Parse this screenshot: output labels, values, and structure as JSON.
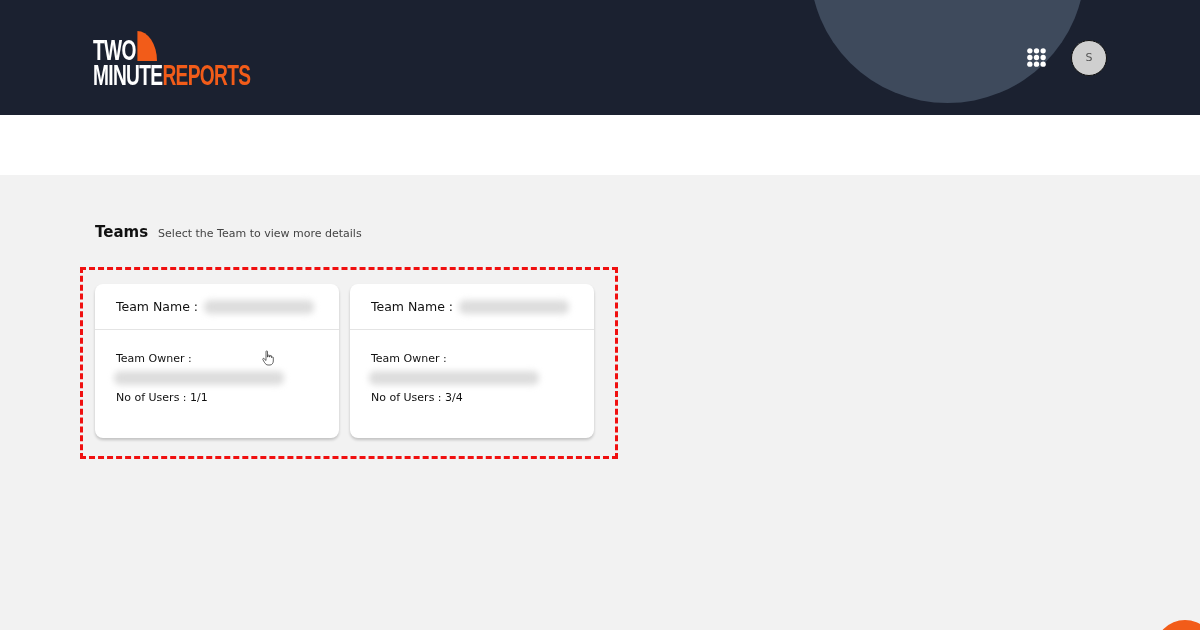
{
  "header": {
    "logo": {
      "line_1": "TWO",
      "line_2_white": "MINUTE",
      "line_2_accent": "REPORTS"
    },
    "avatar": {
      "initial": "S"
    }
  },
  "teams_section": {
    "title": "Teams",
    "subtitle": "Select the Team to view more details",
    "cards": [
      {
        "name_label": "Team Name :",
        "owner_label": "Team Owner :",
        "users": "No of Users : 1/1"
      },
      {
        "name_label": "Team Name :",
        "owner_label": "Team Owner :",
        "users": "No of Users : 3/4"
      }
    ]
  }
}
